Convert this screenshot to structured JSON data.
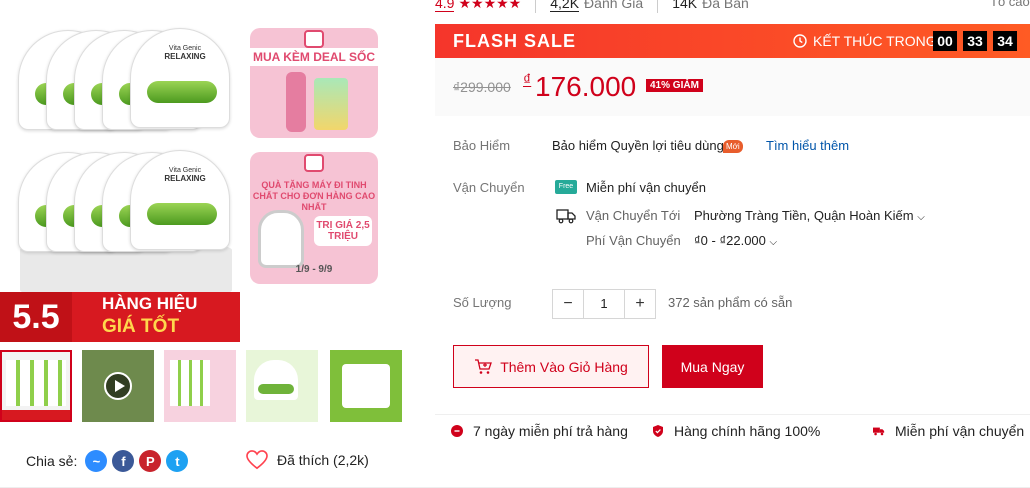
{
  "gallery": {
    "promo1_title": "MUA KÈM DEAL SỐC",
    "promo2_title": "QUÀ TẶNG MÁY ĐI TINH CHẤT CHO ĐƠN HÀNG CAO NHẤT",
    "promo2_value": "TRỊ GIÁ 2,5 TRIỆU",
    "promo2_date": "1/9 - 9/9",
    "mask_brand": "Vita Genic",
    "mask_name": "RELAXING",
    "sale_number": "5.5",
    "sale_line1": "HÀNG HIỆU",
    "sale_line2": "GIÁ TỐT"
  },
  "share": {
    "label": "Chia sẻ:",
    "like_text": "Đã thích (2,2k)"
  },
  "stats": {
    "rating": "4.9",
    "stars": "★★★★★",
    "reviews": "4,2K",
    "reviews_label": "Đánh Giá",
    "sold": "14K",
    "sold_label": "Đã Bán",
    "report": "Tố cáo"
  },
  "flash_sale": {
    "title": "FLASH SALE",
    "ends_label": "KẾT THÚC TRONG",
    "hours": "00",
    "minutes": "33",
    "seconds": "34"
  },
  "price": {
    "original": "₫299.000",
    "currency": "₫",
    "current": "176.000",
    "discount": "41% GIẢM"
  },
  "insurance": {
    "label": "Bảo Hiểm",
    "value": "Bảo hiểm Quyền lợi tiêu dùng",
    "tag": "Mới",
    "link": "Tìm hiểu thêm"
  },
  "shipping": {
    "label": "Vận Chuyển",
    "free": "Miễn phí vận chuyển",
    "to_label": "Vận Chuyển Tới",
    "to_value": "Phường Tràng Tiền, Quận Hoàn Kiếm",
    "fee_label": "Phí Vận Chuyển",
    "fee_value": "₫0 - ₫22.000"
  },
  "quantity": {
    "label": "Số Lượng",
    "minus": "−",
    "value": "1",
    "plus": "+",
    "available": "372 sản phẩm có sẵn"
  },
  "actions": {
    "add_to_cart": "Thêm Vào Giỏ Hàng",
    "buy_now": "Mua Ngay"
  },
  "guarantees": [
    {
      "label": "7 ngày miễn phí trả hàng"
    },
    {
      "label": "Hàng chính hãng 100%"
    },
    {
      "label": "Miễn phí vận chuyển"
    }
  ],
  "colors": {
    "brand_red": "#d0011b",
    "flash_orange": "#f5352b",
    "link_blue": "#0055aa"
  }
}
